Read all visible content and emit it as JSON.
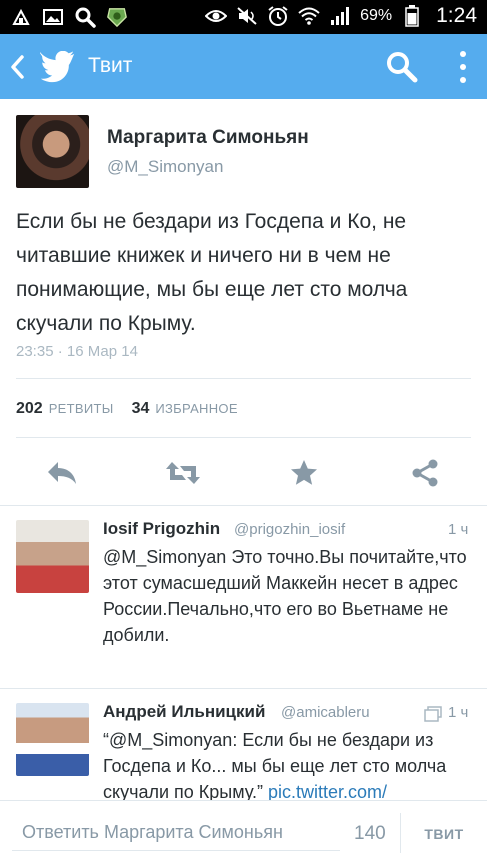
{
  "status_bar": {
    "battery_percent": "69%",
    "time": "1:24"
  },
  "action_bar": {
    "title": "Твит"
  },
  "tweet": {
    "author_name": "Маргарита Симоньян",
    "author_handle": "@M_Simonyan",
    "text": "Если бы не бездари из Госдепа и Ко, не читавшие книжек и ничего ни в чем не понимающие, мы бы еще лет сто молча скучали по Крыму.",
    "timestamp": "23:35 · 16 Мар 14",
    "retweets_count": "202",
    "retweets_label": "РЕТВИТЫ",
    "favorites_count": "34",
    "favorites_label": "ИЗБРАННОЕ"
  },
  "replies": [
    {
      "name": "Iosif Prigozhin",
      "handle": "@prigozhin_iosif",
      "time": "1 ч",
      "text": "@M_Simonyan Это точно.Вы почитайте,что этот сумасшедший Маккейн несет в адрес России.Печально,что его во Вьетнаме не добили."
    },
    {
      "name": "Андрей Ильницкий",
      "handle": "@amicableru",
      "time": "1 ч",
      "text": "“@M_Simonyan: Если бы не бездари из Госдепа и Ко... мы бы еще лет сто молча скучали по Крыму.”",
      "link": "pic.twitter.com/"
    }
  ],
  "compose": {
    "placeholder": "Ответить Маргарита Симоньян",
    "char_count": "140",
    "button_label": "ТВИТ"
  }
}
